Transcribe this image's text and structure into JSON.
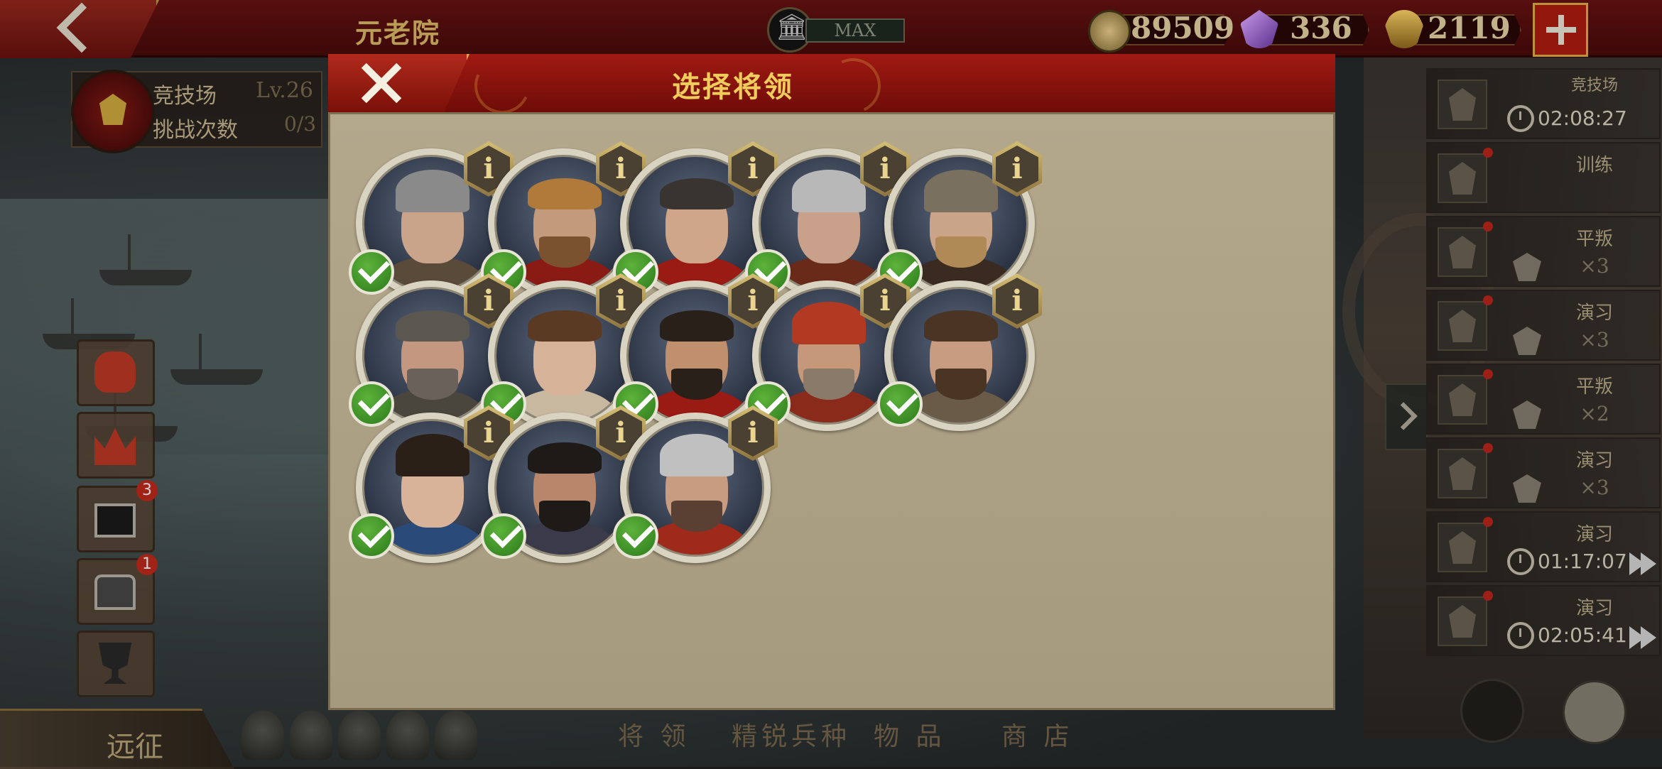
{
  "header": {
    "back_icon": "chevron-left-icon",
    "section_title": "元老院",
    "building_icon": "temple-icon",
    "building_level": "MAX",
    "resources": [
      {
        "icon": "coin-icon",
        "value": "89509"
      },
      {
        "icon": "gem-icon",
        "value": "336"
      },
      {
        "icon": "helmet-icon",
        "value": "2119"
      }
    ],
    "plus_icon": "plus-icon"
  },
  "arena": {
    "label": "竞技场",
    "level": "Lv.26",
    "challenge_label": "挑战次数",
    "challenge_count": "0/3"
  },
  "side_buttons": [
    {
      "icon": "bag-icon",
      "badge": ""
    },
    {
      "icon": "crown-icon",
      "badge": ""
    },
    {
      "icon": "film-icon",
      "badge": "3"
    },
    {
      "icon": "chest-icon",
      "badge": "1"
    },
    {
      "icon": "trophy-icon",
      "badge": ""
    }
  ],
  "expedition_label": "远征",
  "bottom_tabs": [
    "将 领",
    "精锐兵种",
    "物 品",
    "商 店"
  ],
  "tasks": [
    {
      "name": "竞技场",
      "time": "02:08:27"
    },
    {
      "name": "训练",
      "sub": ""
    },
    {
      "name": "平叛",
      "sub": "×3"
    },
    {
      "name": "演习",
      "sub": "×3"
    },
    {
      "name": "平叛",
      "sub": "×2"
    },
    {
      "name": "演习",
      "sub": "×3"
    },
    {
      "name": "演习",
      "time": "01:17:07"
    },
    {
      "name": "演习",
      "time": "02:05:41"
    }
  ],
  "modal": {
    "title": "选择将领",
    "close_icon": "close-icon",
    "info_label": "i",
    "generals": [
      {
        "selected": true,
        "style": "helmet-crest"
      },
      {
        "selected": true,
        "style": "lion-hood"
      },
      {
        "selected": true,
        "style": "short-hair"
      },
      {
        "selected": true,
        "style": "steel-helm"
      },
      {
        "selected": true,
        "style": "winged-helm"
      },
      {
        "selected": true,
        "style": "grey-hair"
      },
      {
        "selected": true,
        "style": "young"
      },
      {
        "selected": true,
        "style": "dark-beard"
      },
      {
        "selected": true,
        "style": "turban"
      },
      {
        "selected": true,
        "style": "fur-collar"
      },
      {
        "selected": true,
        "style": "queen"
      },
      {
        "selected": true,
        "style": "curly"
      },
      {
        "selected": true,
        "style": "knight-helm"
      }
    ]
  },
  "colors": {
    "accent_red": "#8f1510",
    "gold": "#e2c06a",
    "check_green": "#3d9a26",
    "panel_bg": "#b0a488"
  }
}
